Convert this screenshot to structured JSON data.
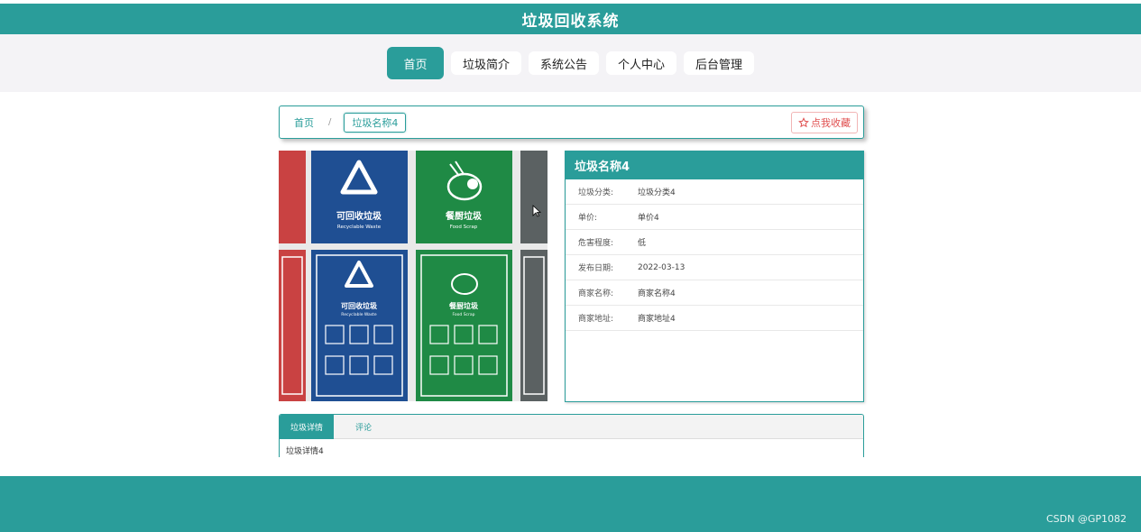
{
  "app": {
    "title": "垃圾回收系统"
  },
  "nav": {
    "items": [
      {
        "label": "首页",
        "active": true
      },
      {
        "label": "垃圾简介",
        "active": false
      },
      {
        "label": "系统公告",
        "active": false
      },
      {
        "label": "个人中心",
        "active": false
      },
      {
        "label": "后台管理",
        "active": false
      }
    ]
  },
  "breadcrumb": {
    "home": "首页",
    "separator": "/",
    "current": "垃圾名称4"
  },
  "favorite": {
    "icon": "star-outline-icon",
    "label": "点我收藏"
  },
  "image": {
    "panels": [
      {
        "cn": "可回收垃圾",
        "en": "Recyclable Waste",
        "color": "#1f4f93"
      },
      {
        "cn": "餐厨垃圾",
        "en": "Food Scrap",
        "color": "#1f8a45"
      }
    ]
  },
  "detail": {
    "title": "垃圾名称4",
    "rows": [
      {
        "label": "垃圾分类:",
        "value": "垃圾分类4"
      },
      {
        "label": "单价:",
        "value": "单价4"
      },
      {
        "label": "危害程度:",
        "value": "低"
      },
      {
        "label": "发布日期:",
        "value": "2022-03-13"
      },
      {
        "label": "商家名称:",
        "value": "商家名称4"
      },
      {
        "label": "商家地址:",
        "value": "商家地址4"
      }
    ]
  },
  "tabs": {
    "items": [
      {
        "label": "垃圾详情",
        "active": true
      },
      {
        "label": "评论",
        "active": false
      }
    ],
    "content": "垃圾详情4"
  },
  "watermark": "CSDN @GP1082",
  "colors": {
    "primary": "#2a9d9a",
    "favorite": "#e05050"
  }
}
